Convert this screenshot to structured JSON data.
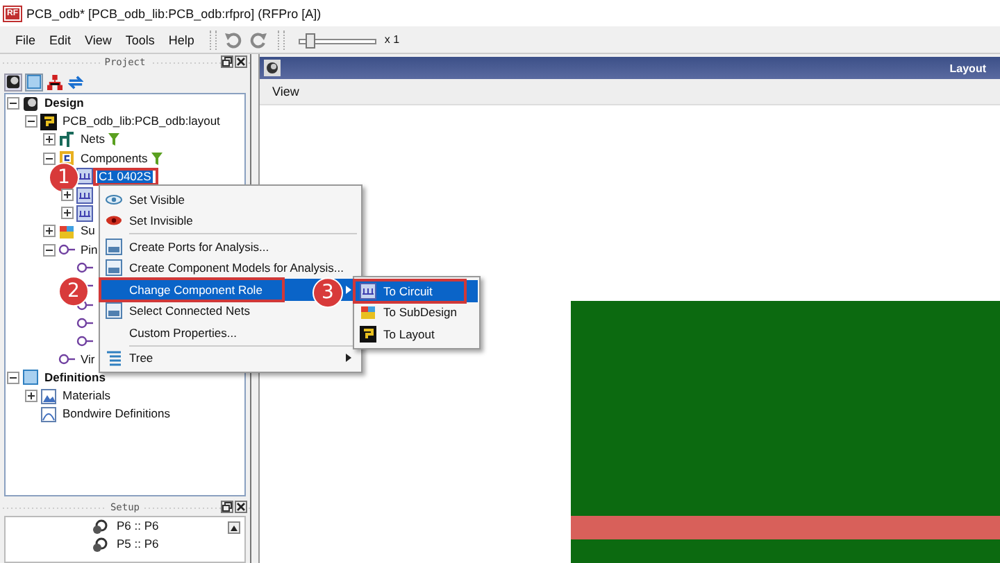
{
  "window": {
    "title": "PCB_odb* [PCB_odb_lib:PCB_odb:rfpro] (RFPro [A])",
    "app_badge": "RF"
  },
  "menu": [
    "File",
    "Edit",
    "View",
    "Tools",
    "Help"
  ],
  "toolbar": {
    "zoom_label": "x 1",
    "level": 0.1
  },
  "project_panel": {
    "title": "Project",
    "tree": [
      {
        "label": "Design",
        "kind": "design",
        "bold": true,
        "expanded": true,
        "selected": false,
        "children": [
          {
            "label": "PCB_odb_lib:PCB_odb:layout",
            "kind": "layout",
            "expanded": true,
            "selected": false,
            "children": [
              {
                "label": "Nets",
                "kind": "nets",
                "expanded": false,
                "filter": true,
                "selected": false
              },
              {
                "label": "Components",
                "kind": "components",
                "expanded": true,
                "filter": true,
                "selected": false,
                "children": [
                  {
                    "label": "C1 0402S",
                    "kind": "part",
                    "selected": true,
                    "callout": "1"
                  },
                  {
                    "kind": "part",
                    "expanded": false,
                    "selected": false
                  },
                  {
                    "kind": "part",
                    "expanded": false,
                    "selected": false
                  }
                ]
              },
              {
                "label": "Su",
                "kind": "subdesign",
                "expanded": false,
                "selected": false
              },
              {
                "label": "Pin",
                "kind": "pin",
                "expanded": true,
                "selected": false,
                "children": [
                  {
                    "kind": "pin",
                    "selected": false
                  },
                  {
                    "kind": "pin",
                    "selected": false
                  },
                  {
                    "kind": "pin",
                    "selected": false
                  },
                  {
                    "kind": "pin",
                    "selected": false
                  },
                  {
                    "kind": "pin",
                    "selected": false
                  }
                ]
              },
              {
                "label": "Vir",
                "kind": "pin",
                "selected": false
              }
            ]
          }
        ]
      },
      {
        "label": "Definitions",
        "kind": "definitions",
        "bold": true,
        "expanded": true,
        "selected": false,
        "children": [
          {
            "label": "Materials",
            "kind": "materials",
            "expanded": false,
            "selected": false
          },
          {
            "label": "Bondwire Definitions",
            "kind": "bondwire",
            "selected": false
          }
        ]
      }
    ]
  },
  "setup_panel": {
    "title": "Setup",
    "items": [
      "P6 :: P6",
      "P5 :: P6"
    ]
  },
  "layout_panel": {
    "title": "Layout",
    "menu": [
      "View"
    ]
  },
  "context_menu": [
    {
      "label": "Set Visible",
      "kind": "visible",
      "selected": false
    },
    {
      "label": "Set Invisible",
      "kind": "invisible",
      "selected": false
    },
    {
      "kind": "separator"
    },
    {
      "label": "Create Ports for Analysis...",
      "kind": "ports",
      "selected": false
    },
    {
      "label": "Create Component Models for Analysis...",
      "kind": "ports",
      "selected": false
    },
    {
      "label": "Change Component Role",
      "kind": "plain",
      "selected": true,
      "submenu": true,
      "callout": "2"
    },
    {
      "label": "Select Connected Nets",
      "kind": "ports",
      "selected": false
    },
    {
      "label": "Custom Properties...",
      "kind": "plain",
      "selected": false
    },
    {
      "kind": "separator"
    },
    {
      "label": "Tree",
      "kind": "tree",
      "selected": false,
      "submenu": true
    }
  ],
  "submenu": [
    {
      "label": "To Circuit",
      "kind": "circuit",
      "selected": true,
      "callout": "3"
    },
    {
      "label": "To SubDesign",
      "kind": "subdesign",
      "selected": false
    },
    {
      "label": "To Layout",
      "kind": "layout",
      "selected": false
    }
  ]
}
